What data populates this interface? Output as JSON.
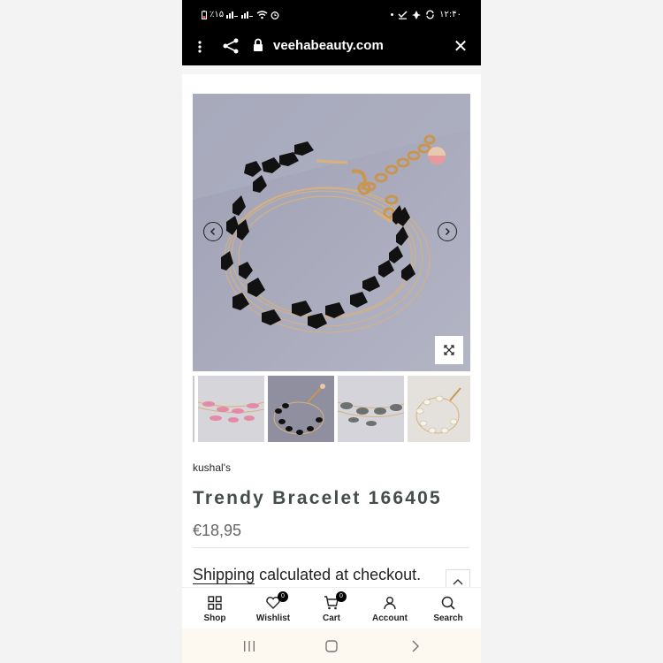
{
  "status_bar": {
    "left_text": "٪۱۵",
    "time": "۱۲:۴۰"
  },
  "url_bar": {
    "url": "veehabeauty.com"
  },
  "icons": {
    "menu": "more-vertical-icon",
    "share": "share-icon",
    "lock": "lock-icon",
    "close": "close-icon",
    "close_glyph": "✕",
    "prev": "chevron-left-icon",
    "next": "chevron-right-icon",
    "zoom": "expand-icon",
    "scroll_top": "chevron-up-icon"
  },
  "product": {
    "brand": "kushal's",
    "title": "Trendy Bracelet 166405",
    "price": "€18,95",
    "shipping_link": "Shipping",
    "shipping_rest": " calculated at checkout."
  },
  "thumbnails": [
    {
      "name": "thumbnail-pink",
      "color": "#d5d5da",
      "bead": "#e58aa6"
    },
    {
      "name": "thumbnail-black",
      "color": "#8f8f9f",
      "bead": "#111111"
    },
    {
      "name": "thumbnail-grey",
      "color": "#d4d4da",
      "bead": "#6c7070"
    },
    {
      "name": "thumbnail-white",
      "color": "#e4e1dc",
      "bead": "#f5f2ea"
    }
  ],
  "bottom_nav": {
    "shop": "Shop",
    "wishlist": "Wishlist",
    "wishlist_count": "0",
    "cart": "Cart",
    "cart_count": "0",
    "account": "Account",
    "search": "Search"
  },
  "colors": {
    "title": "#454d49",
    "image_bg": "#a9aabb",
    "system_bar": "#000000"
  }
}
